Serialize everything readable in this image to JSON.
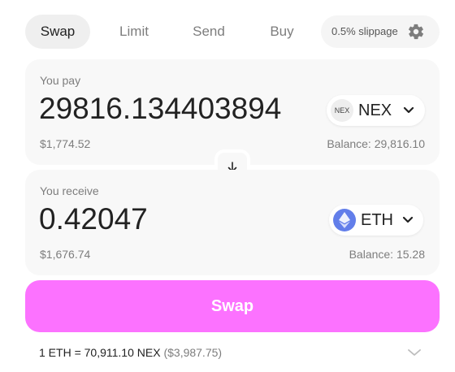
{
  "tabs": [
    {
      "label": "Swap",
      "active": true
    },
    {
      "label": "Limit",
      "active": false
    },
    {
      "label": "Send",
      "active": false
    },
    {
      "label": "Buy",
      "active": false
    }
  ],
  "slippage": {
    "label": "0.5% slippage",
    "icon": "gear-icon"
  },
  "pay": {
    "label": "You pay",
    "amount": "29816.134403894",
    "usd": "$1,774.52",
    "balance": "Balance: 29,816.10",
    "token": {
      "logo_text": "NEX",
      "symbol": "NEX"
    }
  },
  "receive": {
    "label": "You receive",
    "amount": "0.42047",
    "usd": "$1,676.74",
    "balance": "Balance: 15.28",
    "token": {
      "symbol": "ETH",
      "logo_color": "#627eea"
    }
  },
  "switch_icon": "arrow-down-icon",
  "swap_button": {
    "label": "Swap",
    "color": "#fc72ff"
  },
  "rate": {
    "text": "1 ETH = 70,911.10 NEX",
    "usd": "($3,987.75)"
  }
}
